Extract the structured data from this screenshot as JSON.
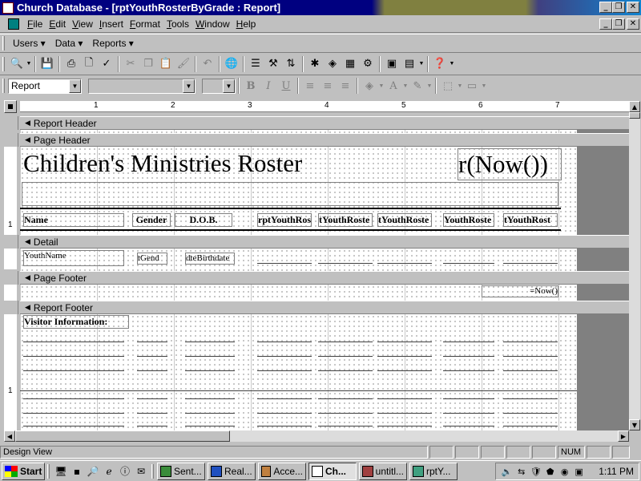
{
  "window": {
    "title": "Church Database - [rptYouthRosterByGrade : Report]",
    "minimize": "_",
    "restore": "❐",
    "close": "✕"
  },
  "menubar": {
    "items": [
      "File",
      "Edit",
      "View",
      "Insert",
      "Format",
      "Tools",
      "Window",
      "Help"
    ]
  },
  "custom_toolbar": {
    "items": [
      "Users ▾",
      "Data ▾",
      "Reports ▾"
    ]
  },
  "design_toolbar": {
    "icons": [
      "view-icon",
      "save-icon",
      "print-icon",
      "print-preview-icon",
      "spelling-icon",
      "cut-icon",
      "copy-icon",
      "paste-icon",
      "format-painter-icon",
      "undo-icon",
      "insert-hyperlink-icon",
      "field-list-icon",
      "toolbox-icon",
      "sorting-grouping-icon",
      "autoformat-icon",
      "code-icon",
      "properties-icon",
      "build-icon",
      "database-window-icon",
      "new-object-icon",
      "help-icon"
    ]
  },
  "format_toolbar": {
    "object_combo": "Report",
    "font_combo": "",
    "size_combo": "",
    "bold": "B",
    "italic": "I",
    "underline": "U"
  },
  "ruler": {
    "marks": [
      "1",
      "2",
      "3",
      "4",
      "5",
      "6",
      "7"
    ],
    "vmarks": [
      "1",
      "1"
    ]
  },
  "sections": {
    "report_header": "Report Header",
    "page_header": "Page Header",
    "detail": "Detail",
    "page_footer": "Page Footer",
    "report_footer": "Report Footer"
  },
  "controls": {
    "title": "Children's Ministries Roster",
    "title_expr": "r(Now())",
    "col_name": "Name",
    "col_gender": "Gender",
    "col_dob": "D.O.B.",
    "col_4": "rptYouthRos",
    "col_5": "tYouthRoste",
    "col_6": "tYouthRoste",
    "col_7": "YouthRoste",
    "col_8": "tYouthRost",
    "detail_name": "YouthName",
    "detail_gender": "tGend",
    "detail_dob": "dteBirthdate",
    "footer_now": "=Now()",
    "visitor_info": "Visitor Information:"
  },
  "statusbar": {
    "text": "Design View",
    "num": "NUM"
  },
  "taskbar": {
    "start": "Start",
    "tasks": [
      "Sent...",
      "Real...",
      "Acce...",
      "Ch...",
      "untitl...",
      "rptY..."
    ],
    "clock": "1:11 PM"
  },
  "colors": {
    "title_active": "#000080",
    "face": "#c0c0c0",
    "canvas_gray": "#808080"
  }
}
